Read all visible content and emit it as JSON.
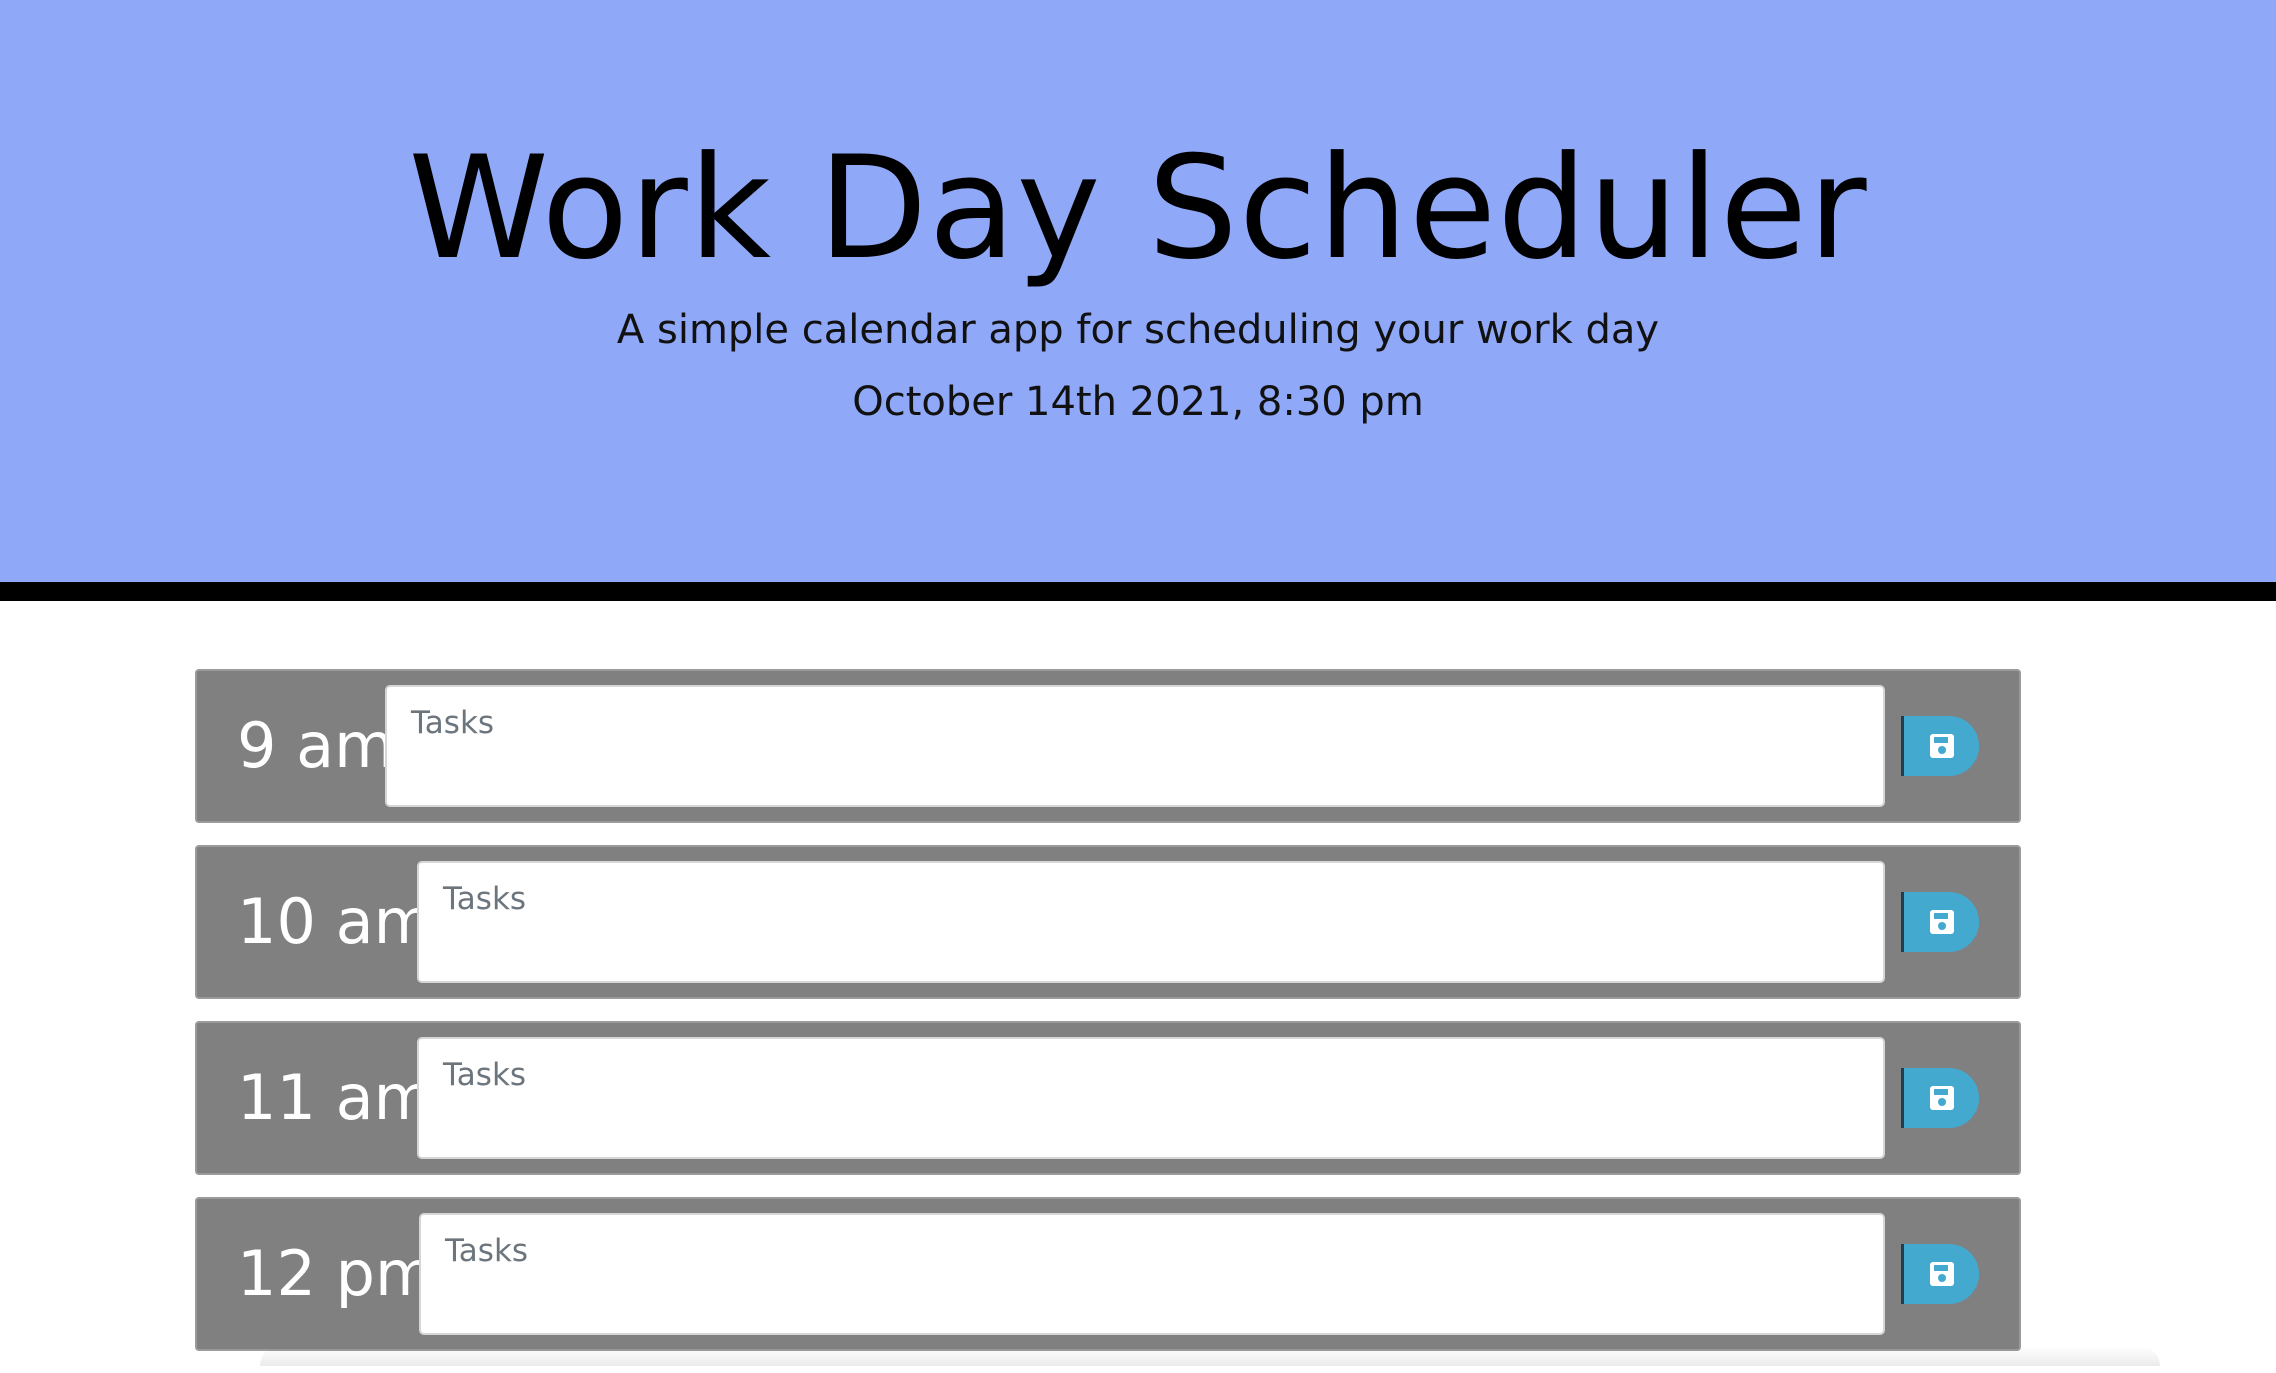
{
  "header": {
    "title": "Work Day Scheduler",
    "subtitle": "A simple calendar app for scheduling your work day",
    "current_date": "October 14th 2021, 8:30 pm"
  },
  "colors": {
    "header_background": "#8fa8f8",
    "time_block_background": "#808080",
    "save_button": "#44a9cf"
  },
  "time_blocks": [
    {
      "hour": "9 am",
      "tasks_value": "",
      "tasks_placeholder": "Tasks",
      "save_icon": "save-icon"
    },
    {
      "hour": "10 am",
      "tasks_value": "",
      "tasks_placeholder": "Tasks",
      "save_icon": "save-icon"
    },
    {
      "hour": "11 am",
      "tasks_value": "",
      "tasks_placeholder": "Tasks",
      "save_icon": "save-icon"
    },
    {
      "hour": "12 pm",
      "tasks_value": "",
      "tasks_placeholder": "Tasks",
      "save_icon": "save-icon"
    }
  ]
}
